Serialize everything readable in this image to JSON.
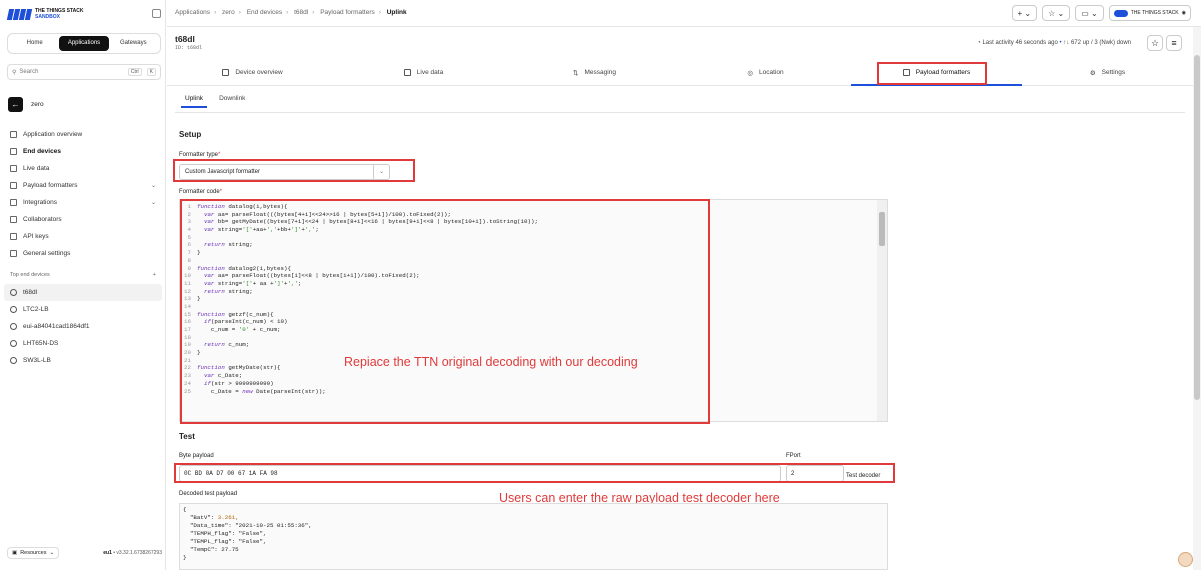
{
  "brand": {
    "name": "THE THINGS STACK",
    "sub": "SANDBOX"
  },
  "sidebar": {
    "top_tabs": [
      "Home",
      "Applications",
      "Gateways"
    ],
    "active_top_tab": "Applications",
    "search": {
      "placeholder": "Search",
      "kbd1": "Ctrl",
      "kbd2": "K"
    },
    "app_name": "zero",
    "nav": [
      {
        "label": "Application overview",
        "icon": "grid-icon"
      },
      {
        "label": "End devices",
        "icon": "device-icon",
        "active": true
      },
      {
        "label": "Live data",
        "icon": "list-icon"
      },
      {
        "label": "Payload formatters",
        "icon": "code-icon",
        "chevron": "⌄"
      },
      {
        "label": "Integrations",
        "icon": "plug-icon",
        "chevron": "⌄"
      },
      {
        "label": "Collaborators",
        "icon": "users-icon"
      },
      {
        "label": "API keys",
        "icon": "key-icon"
      },
      {
        "label": "General settings",
        "icon": "gear-icon"
      }
    ],
    "devices_header": "Top end devices",
    "devices_add": "+",
    "devices": [
      "t68dl",
      "LTC2-LB",
      "eui-a84041cad1864df1",
      "LHT65N-DS",
      "SW3L-LB"
    ],
    "resources_label": "Resources",
    "region": "eu1",
    "version": "• v3.32.1.6738267293"
  },
  "breadcrumb": [
    "Applications",
    "zero",
    "End devices",
    "t68dl",
    "Payload formatters",
    "Uplink"
  ],
  "header_buttons": {
    "plus": "+ ⌄",
    "star": "☆ ⌄",
    "inbox": "▭ ⌄",
    "user_label": "THE THINGS STACK"
  },
  "device": {
    "title": "t68dl",
    "id": "ID: t68dl",
    "activity": "Last activity 46 seconds ago",
    "traffic": "↑↓ 672 up / 3 (Nwk) down",
    "star_icon": "☆",
    "menu_icon": "≡"
  },
  "tabs": [
    {
      "label": "Device overview",
      "icon": "device-icon"
    },
    {
      "label": "Live data",
      "icon": "list-icon"
    },
    {
      "label": "Messaging",
      "icon": "arrows-icon"
    },
    {
      "label": "Location",
      "icon": "pin-icon"
    },
    {
      "label": "Payload formatters",
      "icon": "code-icon",
      "active": true
    },
    {
      "label": "Settings",
      "icon": "gear-icon"
    }
  ],
  "subtabs": [
    "Uplink",
    "Downlink"
  ],
  "setup": {
    "heading": "Setup",
    "formatter_type_label": "Formatter type",
    "required_mark": "*",
    "formatter_type_value": "Custom Javascript formatter",
    "formatter_code_label": "Formatter code"
  },
  "code_lines": [
    "1 function datalog(i,bytes){",
    "2   var aa= parseFloat(((bytes[4+i]<<24>>16 | bytes[5+i])/100).toFixed(2));",
    "3   var bb= getMyDate((bytes[7+i]<<24 | bytes[8+i]<<16 | bytes[9+i]<<8 | bytes[10+i]).toString(10));",
    "4   var string='['+aa+','+bb+']'+',';",
    "5",
    "6   return string;",
    "7 }",
    "8",
    "9 function datalog2(i,bytes){",
    "10   var aa= parseFloat((bytes[i]<<8 | bytes[i+1])/100).toFixed(2);",
    "11   var string='['+ aa +']'+',';",
    "12   return string;",
    "13 }",
    "14",
    "15 function getzf(c_num){",
    "16   if(parseInt(c_num) < 10)",
    "17     c_num = '0' + c_num;",
    "18",
    "19   return c_num;",
    "20 }",
    "21",
    "22 function getMyDate(str){",
    "23   var c_Date;",
    "24   if(str > 9999999999)",
    "25     c_Date = new Date(parseInt(str));"
  ],
  "annotation_1": "Repiace the TTN original decoding with our decoding",
  "test": {
    "heading": "Test",
    "byte_payload_label": "Byte payload",
    "byte_payload_value": "0C BD 0A D7 00 67 1A FA 98",
    "fport_label": "FPort",
    "fport_value": "2",
    "test_button": "Test decoder",
    "decoded_label": "Decoded test payload"
  },
  "annotation_2": "Users can enter the raw payload test decoder here",
  "decoded_lines": [
    "{",
    "  \"BatV\": 3.261,",
    "  \"Data_time\": \"2021-10-25 01:55:36\",",
    "  \"TEMPH_flag\": \"False\",",
    "  \"TEMPL_flag\": \"False\",",
    "  \"TempC\": 27.75",
    "}"
  ],
  "colors": {
    "accent": "#1d4fd8",
    "annotation": "#e03a3a"
  }
}
